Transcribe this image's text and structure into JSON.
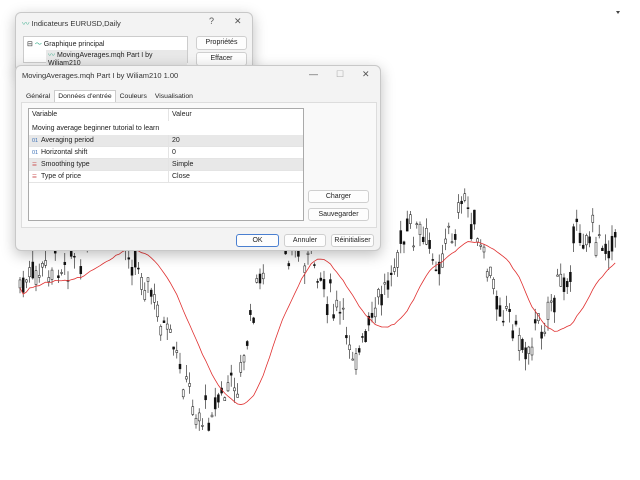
{
  "back_dialog": {
    "title": "Indicateurs EURUSD,Daily",
    "help": "?",
    "close": "✕",
    "tree": {
      "root": "Graphique principal",
      "child": "MovingAverages.mqh Part I by Wiliam210"
    },
    "buttons": {
      "properties": "Propriétés",
      "clear": "Effacer"
    }
  },
  "front_dialog": {
    "title": "MovingAverages.mqh Part I by Wiliam210 1.00",
    "minimize": "—",
    "maximize": "☐",
    "close": "✕",
    "tabs": [
      "Général",
      "Données d'entrée",
      "Couleurs",
      "Visualisation"
    ],
    "table": {
      "headers": [
        "Variable",
        "Valeur"
      ],
      "description": "Moving average beginner tutorial to learn",
      "rows": [
        {
          "icon": "01",
          "name": "Averaging period",
          "value": "20"
        },
        {
          "icon": "01",
          "name": "Horizontal shift",
          "value": "0"
        },
        {
          "icon": "enum",
          "name": "Smoothing type",
          "value": "Simple"
        },
        {
          "icon": "enum",
          "name": "Type of price",
          "value": "Close"
        }
      ]
    },
    "buttons": {
      "load": "Charger",
      "save": "Sauvegarder",
      "ok": "OK",
      "cancel": "Annuler",
      "reset": "Réinitialiser"
    }
  },
  "colors": {
    "ma_line": "#e03030",
    "candles": "#111111"
  }
}
